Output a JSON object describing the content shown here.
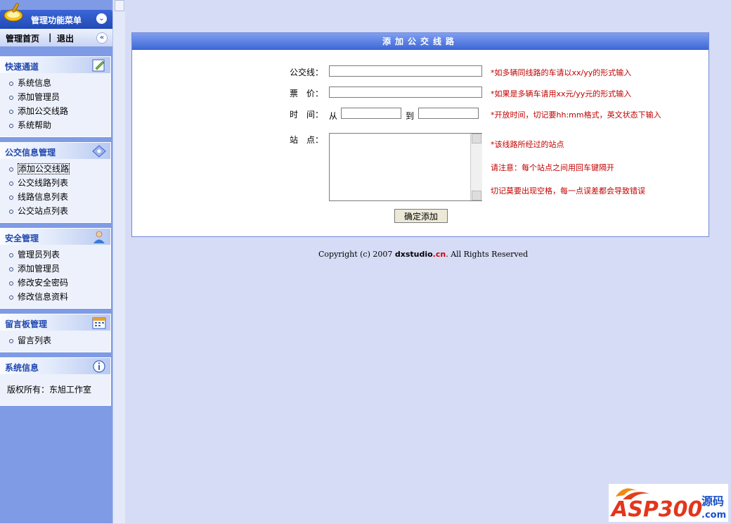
{
  "sidebar": {
    "header": {
      "title": "管理功能菜单",
      "collapse_glyph": "⌄"
    },
    "topnav": {
      "home": "管理首页",
      "separator": "|",
      "logout": "退出",
      "back_glyph": "«"
    },
    "panels": [
      {
        "title": "快速通道",
        "icon": "edit-icon",
        "items": [
          "系统信息",
          "添加管理员",
          "添加公交线路",
          "系统帮助"
        ]
      },
      {
        "title": "公交信息管理",
        "icon": "diamond-icon",
        "items": [
          "添加公交线路",
          "公交线路列表",
          "线路信息列表",
          "公交站点列表"
        ],
        "active": 0
      },
      {
        "title": "安全管理",
        "icon": "user-icon",
        "items": [
          "管理员列表",
          "添加管理员",
          "修改安全密码",
          "修改信息资料"
        ]
      },
      {
        "title": "留言板管理",
        "icon": "calendar-icon",
        "items": [
          "留言列表"
        ]
      },
      {
        "title": "系统信息",
        "icon": "info-icon",
        "info": "版权所有：东旭工作室"
      }
    ]
  },
  "form": {
    "title": "添加公交线路",
    "line_label": "公交线：",
    "price_label": "票　价：",
    "time_label": "时　间：",
    "time_from": "从",
    "time_to": "到",
    "stops_label": "站　点：",
    "line_value": "",
    "price_value": "",
    "time_from_value": "",
    "time_to_value": "",
    "stops_value": "",
    "hint_line": "*如多辆同线路的车请以xx/yy的形式输入",
    "hint_price": "*如果是多辆车请用xx元/yy元的形式输入",
    "hint_time": "*开放时间，切记要hh:mm格式，英文状态下输入",
    "hint_stops": "*该线路所经过的站点",
    "note1": "请注意：每个站点之间用回车键隔开",
    "note2": "切记莫要出现空格，每一点误差都会导致错误",
    "submit": "确定添加"
  },
  "footer": {
    "prefix": "Copyright (c) 2007 ",
    "brand": "dxstudio",
    "brand_tld": ".cn",
    "suffix": ". All Rights Reserved"
  },
  "watermark": {
    "main": "ASP300",
    "cn": "源码",
    "tld": ".com"
  },
  "colors": {
    "accent": "#3c66d6",
    "sidebar": "#7f9be6",
    "background": "#d6dcf6",
    "hint": "#c10000"
  }
}
